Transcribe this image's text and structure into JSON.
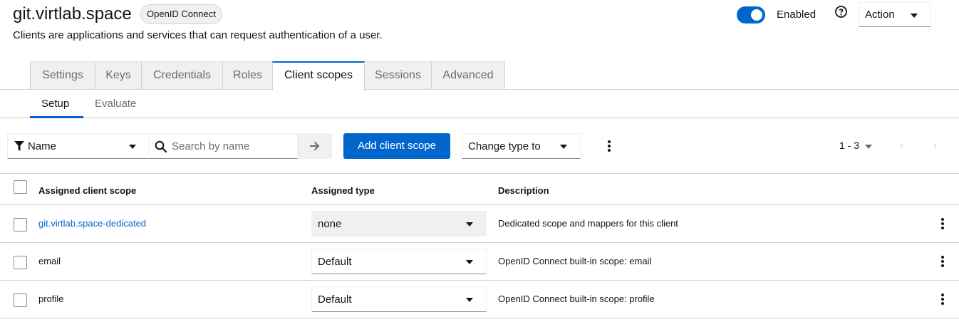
{
  "header": {
    "title": "git.virtlab.space",
    "protocol_badge": "OpenID Connect",
    "subtitle": "Clients are applications and services that can request authentication of a user.",
    "enabled_label": "Enabled",
    "enabled": true,
    "action_label": "Action"
  },
  "tabs": [
    {
      "label": "Settings",
      "active": false
    },
    {
      "label": "Keys",
      "active": false
    },
    {
      "label": "Credentials",
      "active": false
    },
    {
      "label": "Roles",
      "active": false
    },
    {
      "label": "Client scopes",
      "active": true
    },
    {
      "label": "Sessions",
      "active": false
    },
    {
      "label": "Advanced",
      "active": false
    }
  ],
  "subtabs": [
    {
      "label": "Setup",
      "active": true
    },
    {
      "label": "Evaluate",
      "active": false
    }
  ],
  "toolbar": {
    "filter_label": "Name",
    "search_placeholder": "Search by name",
    "add_button": "Add client scope",
    "change_type_label": "Change type to",
    "pagination": "1 - 3"
  },
  "table": {
    "headers": {
      "scope": "Assigned client scope",
      "type": "Assigned type",
      "description": "Description"
    },
    "rows": [
      {
        "scope": "git.virtlab.space-dedicated",
        "type": "none",
        "description": "Dedicated scope and mappers for this client",
        "link": true,
        "type_disabled": true
      },
      {
        "scope": "email",
        "type": "Default",
        "description": "OpenID Connect built-in scope: email",
        "link": false,
        "type_disabled": false
      },
      {
        "scope": "profile",
        "type": "Default",
        "description": "OpenID Connect built-in scope: profile",
        "link": false,
        "type_disabled": false
      }
    ]
  },
  "colors": {
    "accent": "#0066cc",
    "border": "#d2d2d2",
    "muted_text": "#6a6e73"
  }
}
